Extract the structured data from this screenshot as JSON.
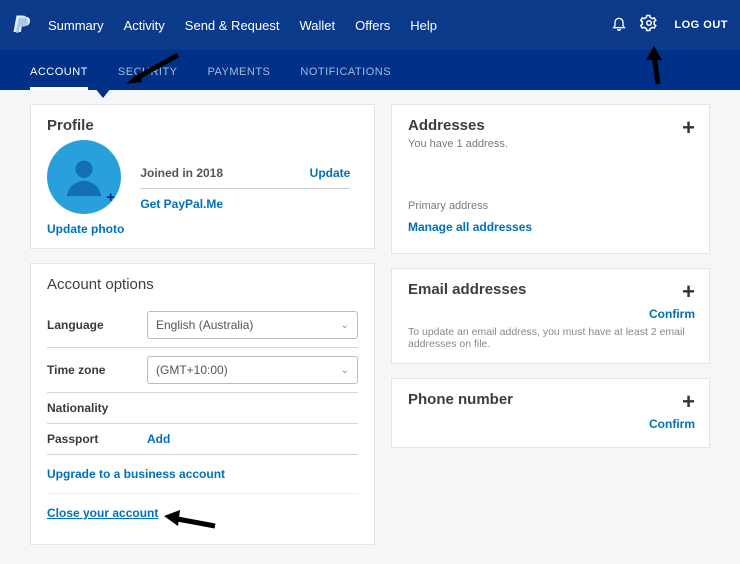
{
  "nav": {
    "summary": "Summary",
    "activity": "Activity",
    "send": "Send & Request",
    "wallet": "Wallet",
    "offers": "Offers",
    "help": "Help",
    "logout": "LOG OUT"
  },
  "subnav": {
    "account": "ACCOUNT",
    "security": "SECURITY",
    "payments": "PAYMENTS",
    "notifications": "NOTIFICATIONS"
  },
  "profile": {
    "title": "Profile",
    "joined": "Joined in 2018",
    "update": "Update",
    "getpplme": "Get PayPal.Me",
    "updatePhoto": "Update photo"
  },
  "options": {
    "title": "Account options",
    "langLabel": "Language",
    "langValue": "English (Australia)",
    "tzLabel": "Time zone",
    "tzValue": "(GMT+10:00)",
    "natLabel": "Nationality",
    "passLabel": "Passport",
    "add": "Add",
    "upgrade": "Upgrade to a business account",
    "close": "Close your account"
  },
  "addresses": {
    "title": "Addresses",
    "subtitle": "You have 1 address.",
    "primary": "Primary address",
    "manage": "Manage all addresses"
  },
  "emails": {
    "title": "Email addresses",
    "confirm": "Confirm",
    "help": "To update an email address, you must have at least 2 email addresses on file."
  },
  "phone": {
    "title": "Phone number",
    "confirm": "Confirm"
  }
}
